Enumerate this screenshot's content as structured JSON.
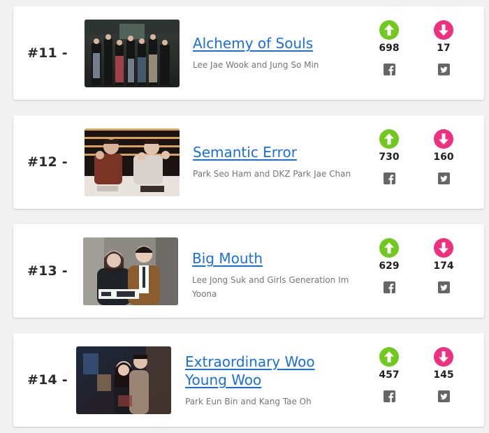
{
  "colors": {
    "upvote": "#71c81e",
    "downvote": "#ef2f80",
    "title_link": "#1a6fe0",
    "share_icon": "#666666"
  },
  "items": [
    {
      "rank": "#11 -",
      "title": "Alchemy of Souls",
      "actors": "Lee Jae Wook and Jung So Min",
      "upvotes": "698",
      "downvotes": "17",
      "upvote_icon": "arrow-up-circle-icon",
      "downvote_icon": "arrow-down-circle-icon",
      "share_left_icon": "facebook-icon",
      "share_right_icon": "twitter-icon"
    },
    {
      "rank": "#12 -",
      "title": "Semantic Error",
      "actors": "Park Seo Ham and DKZ Park Jae Chan",
      "upvotes": "730",
      "downvotes": "160",
      "upvote_icon": "arrow-up-circle-icon",
      "downvote_icon": "arrow-down-circle-icon",
      "share_left_icon": "facebook-icon",
      "share_right_icon": "twitter-icon"
    },
    {
      "rank": "#13 -",
      "title": "Big Mouth",
      "actors": "Lee Jong Suk and Girls Generation Im Yoona",
      "upvotes": "629",
      "downvotes": "174",
      "upvote_icon": "arrow-up-circle-icon",
      "downvote_icon": "arrow-down-circle-icon",
      "share_left_icon": "facebook-icon",
      "share_right_icon": "twitter-icon"
    },
    {
      "rank": "#14 -",
      "title": "Extraordinary Woo Young Woo",
      "actors": "Park Eun Bin and Kang Tae Oh",
      "upvotes": "457",
      "downvotes": "145",
      "upvote_icon": "arrow-up-circle-icon",
      "downvote_icon": "arrow-down-circle-icon",
      "share_left_icon": "facebook-icon",
      "share_right_icon": "twitter-icon"
    }
  ]
}
